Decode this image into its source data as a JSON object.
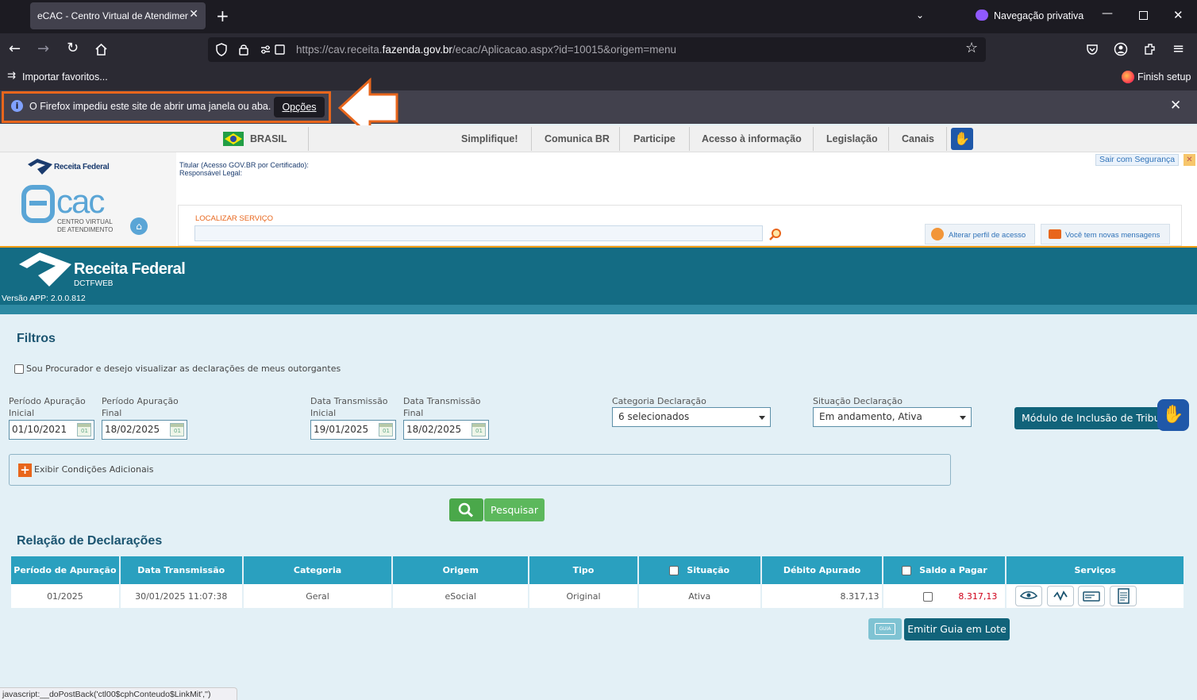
{
  "browser": {
    "tab_title": "eCAC - Centro Virtual de Atendimento",
    "tab_close": "✕",
    "new_tab": "+",
    "private_label": "Navegação privativa",
    "url_prefix": "https://cav.receita.",
    "url_domain": "fazenda.gov.br",
    "url_suffix": "/ecac/Aplicacao.aspx?id=10015&origem=menu",
    "bookmark_import": "Importar favoritos...",
    "finish_setup": "Finish setup",
    "notification_text": "O Firefox impediu este site de abrir uma janela ou aba.",
    "notification_button": "Opções",
    "status_bar": "javascript:__doPostBack('ctl00$cphConteudo$LinkMit','')"
  },
  "govbar": {
    "country": "BRASIL",
    "links": [
      "Simplifique!",
      "Comunica BR",
      "Participe",
      "Acesso à informação",
      "Legislação",
      "Canais"
    ]
  },
  "ecac": {
    "rf_small": "Receita Federal",
    "logo_text": "cac",
    "logo_sub1": "CENTRO VIRTUAL",
    "logo_sub2": "DE ATENDIMENTO",
    "titular": "Titular (Acesso GOV.BR por Certificado):",
    "responsavel": "Responsável Legal:",
    "sair": "Sair com Segurança",
    "localizar": "LOCALIZAR SERVIÇO",
    "alterar_perfil": "Alterar perfil de acesso",
    "mensagens": "Você tem novas mensagens"
  },
  "app": {
    "brand": "Receita Federal",
    "subtitle": "DCTFWEB",
    "version": "Versão APP: 2.0.0.812"
  },
  "filters": {
    "title": "Filtros",
    "procurador_label": "Sou Procurador e desejo visualizar as declarações de meus outorgantes",
    "periodo_inicial_label_1": "Período Apuração",
    "periodo_inicial_label_2": "Inicial",
    "periodo_inicial": "01/10/2021",
    "periodo_final_label_1": "Período Apuração",
    "periodo_final_label_2": "Final",
    "periodo_final": "18/02/2025",
    "transm_inicial_label_1": "Data Transmissão",
    "transm_inicial_label_2": "Inicial",
    "transm_inicial": "19/01/2025",
    "transm_final_label_1": "Data Transmissão",
    "transm_final_label_2": "Final",
    "transm_final": "18/02/2025",
    "categoria_label": "Categoria Declaração",
    "categoria_value": "6 selecionados",
    "situacao_label": "Situação Declaração",
    "situacao_value": "Em andamento, Ativa",
    "modulo_button": "Módulo de Inclusão de Tribut",
    "exibir_condicoes": "Exibir Condições Adicionais",
    "pesquisar": "Pesquisar",
    "cal_day": "01"
  },
  "declarations": {
    "title": "Relação de Declarações",
    "headers": [
      "Período de Apuração",
      "Data Transmissão",
      "Categoria",
      "Origem",
      "Tipo",
      "Situação",
      "Débito Apurado",
      "Saldo a Pagar",
      "Serviços"
    ],
    "rows": [
      {
        "periodo": "01/2025",
        "data": "30/01/2025 11:07:38",
        "categoria": "Geral",
        "origem": "eSocial",
        "tipo": "Original",
        "situacao": "Ativa",
        "debito": "8.317,13",
        "saldo": "8.317,13"
      }
    ],
    "emitir_lote": "Emitir Guia em Lote",
    "gps_icon_label": "GUIA"
  },
  "colors": {
    "accent_orange": "#e8661c",
    "rf_teal": "#146c84",
    "table_header": "#2aa0bf",
    "saldo_red": "#d0021b",
    "pesquisar_green": "#5cb85c"
  }
}
